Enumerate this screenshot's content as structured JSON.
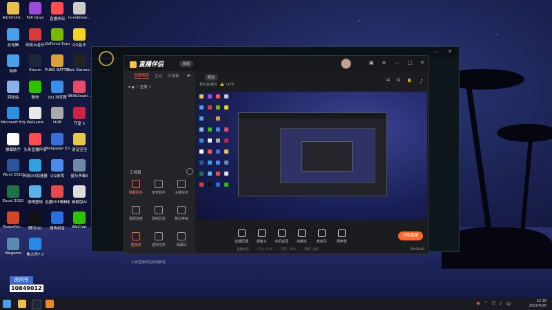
{
  "desktop_icons": [
    {
      "label": "Administr...",
      "color": "#e8c04a"
    },
    {
      "label": "Fall Guys",
      "color": "#9b4bd9"
    },
    {
      "label": "直播伴侣",
      "color": "#ff4d4d"
    },
    {
      "label": "rs-vsblose...",
      "color": "#cccccc"
    },
    {
      "label": "此电脑",
      "color": "#4aa0e8"
    },
    {
      "label": "网易云音乐",
      "color": "#d83a3a"
    },
    {
      "label": "GeForce Experience",
      "color": "#76b900"
    },
    {
      "label": "QQ音乐",
      "color": "#f2d324"
    },
    {
      "label": "网络",
      "color": "#4aa0e8"
    },
    {
      "label": "Steam",
      "color": "#1b2838"
    },
    {
      "label": "PUBG BATTLEGR...",
      "color": "#d9a03a"
    },
    {
      "label": "Epic Games Launcher",
      "color": "#222222"
    },
    {
      "label": "回收站",
      "color": "#8ab4e8"
    },
    {
      "label": "微信",
      "color": "#2dc100"
    },
    {
      "label": "QQ 浏览器",
      "color": "#3a8ee8"
    },
    {
      "label": "983b2eadi...",
      "color": "#e84a6a"
    },
    {
      "label": "Microsoft Edge",
      "color": "#2d8fe0"
    },
    {
      "label": "WeGame",
      "color": "#e8e8e8"
    },
    {
      "label": "HUB",
      "color": "#aaaaaa"
    },
    {
      "label": "守望 5",
      "color": "#cc2244"
    },
    {
      "label": "弹幕助手",
      "color": "#ffffff"
    },
    {
      "label": "头条直播伴侣",
      "color": "#ff4d4d"
    },
    {
      "label": "Wallpaper Engine",
      "color": "#3a6ed8"
    },
    {
      "label": "语音宝宝",
      "color": "#e8c84a"
    },
    {
      "label": "Word 2010",
      "color": "#2b579a"
    },
    {
      "label": "网易UU加速器",
      "color": "#30a0e0"
    },
    {
      "label": "QQ游戏",
      "color": "#4a8ae8"
    },
    {
      "label": "星际争霸II",
      "color": "#6a8aa8"
    },
    {
      "label": "Excel 2010",
      "color": "#217346"
    },
    {
      "label": "咖啡壁纸",
      "color": "#5ab0e8"
    },
    {
      "label": "迅捷PDF编辑器",
      "color": "#e84a4a"
    },
    {
      "label": "破解版AI",
      "color": "#dddddd"
    },
    {
      "label": "PowerPoi...",
      "color": "#d24726"
    },
    {
      "label": "腾讯QQ",
      "color": "#111111"
    },
    {
      "label": "搜狗拼音",
      "color": "#2a6fe0"
    },
    {
      "label": "WeChat",
      "color": "#2dc100"
    },
    {
      "label": "Wegame",
      "color": "#5a8ab0"
    },
    {
      "label": "鲁大师7.0",
      "color": "#2a8ae8"
    }
  ],
  "room": {
    "tag": "房间号",
    "number": "10849012"
  },
  "app": {
    "name": "直播伴侣",
    "version": "新版",
    "tabs": [
      "直播场景",
      "互动",
      "可录素"
    ],
    "scene": "全屏 1",
    "tools_title": "工具箱",
    "tools": [
      {
        "label": "弹幕助手",
        "red": true
      },
      {
        "label": "房管助手",
        "red": false
      },
      {
        "label": "主播任务",
        "red": false
      },
      {
        "label": "视频连麦",
        "red": false
      },
      {
        "label": "录制回放",
        "red": false
      },
      {
        "label": "精华等级",
        "red": false
      },
      {
        "label": "直播商",
        "red": true
      },
      {
        "label": "虚拟形象",
        "red": false
      },
      {
        "label": "弹幕机",
        "red": false
      }
    ],
    "bottom_tip": "头条直播伴侣使用教程",
    "preview_label": "预览",
    "meta_left": "我的直播间",
    "meta_count": "1478",
    "controls": [
      {
        "label": "直播屏幕"
      },
      {
        "label": "摄像头"
      },
      {
        "label": "手机投屏"
      },
      {
        "label": "多媒体"
      },
      {
        "label": "麦克风"
      },
      {
        "label": "扬声器"
      }
    ],
    "start_label": "开始直播",
    "status": [
      "直播状态",
      "CPU: 12%",
      "内存: 38%",
      "网络: 良好"
    ],
    "timer": "00:00:00"
  },
  "taskbar": {
    "time": "22:18",
    "date": "2022/9/26",
    "ime": "中"
  }
}
